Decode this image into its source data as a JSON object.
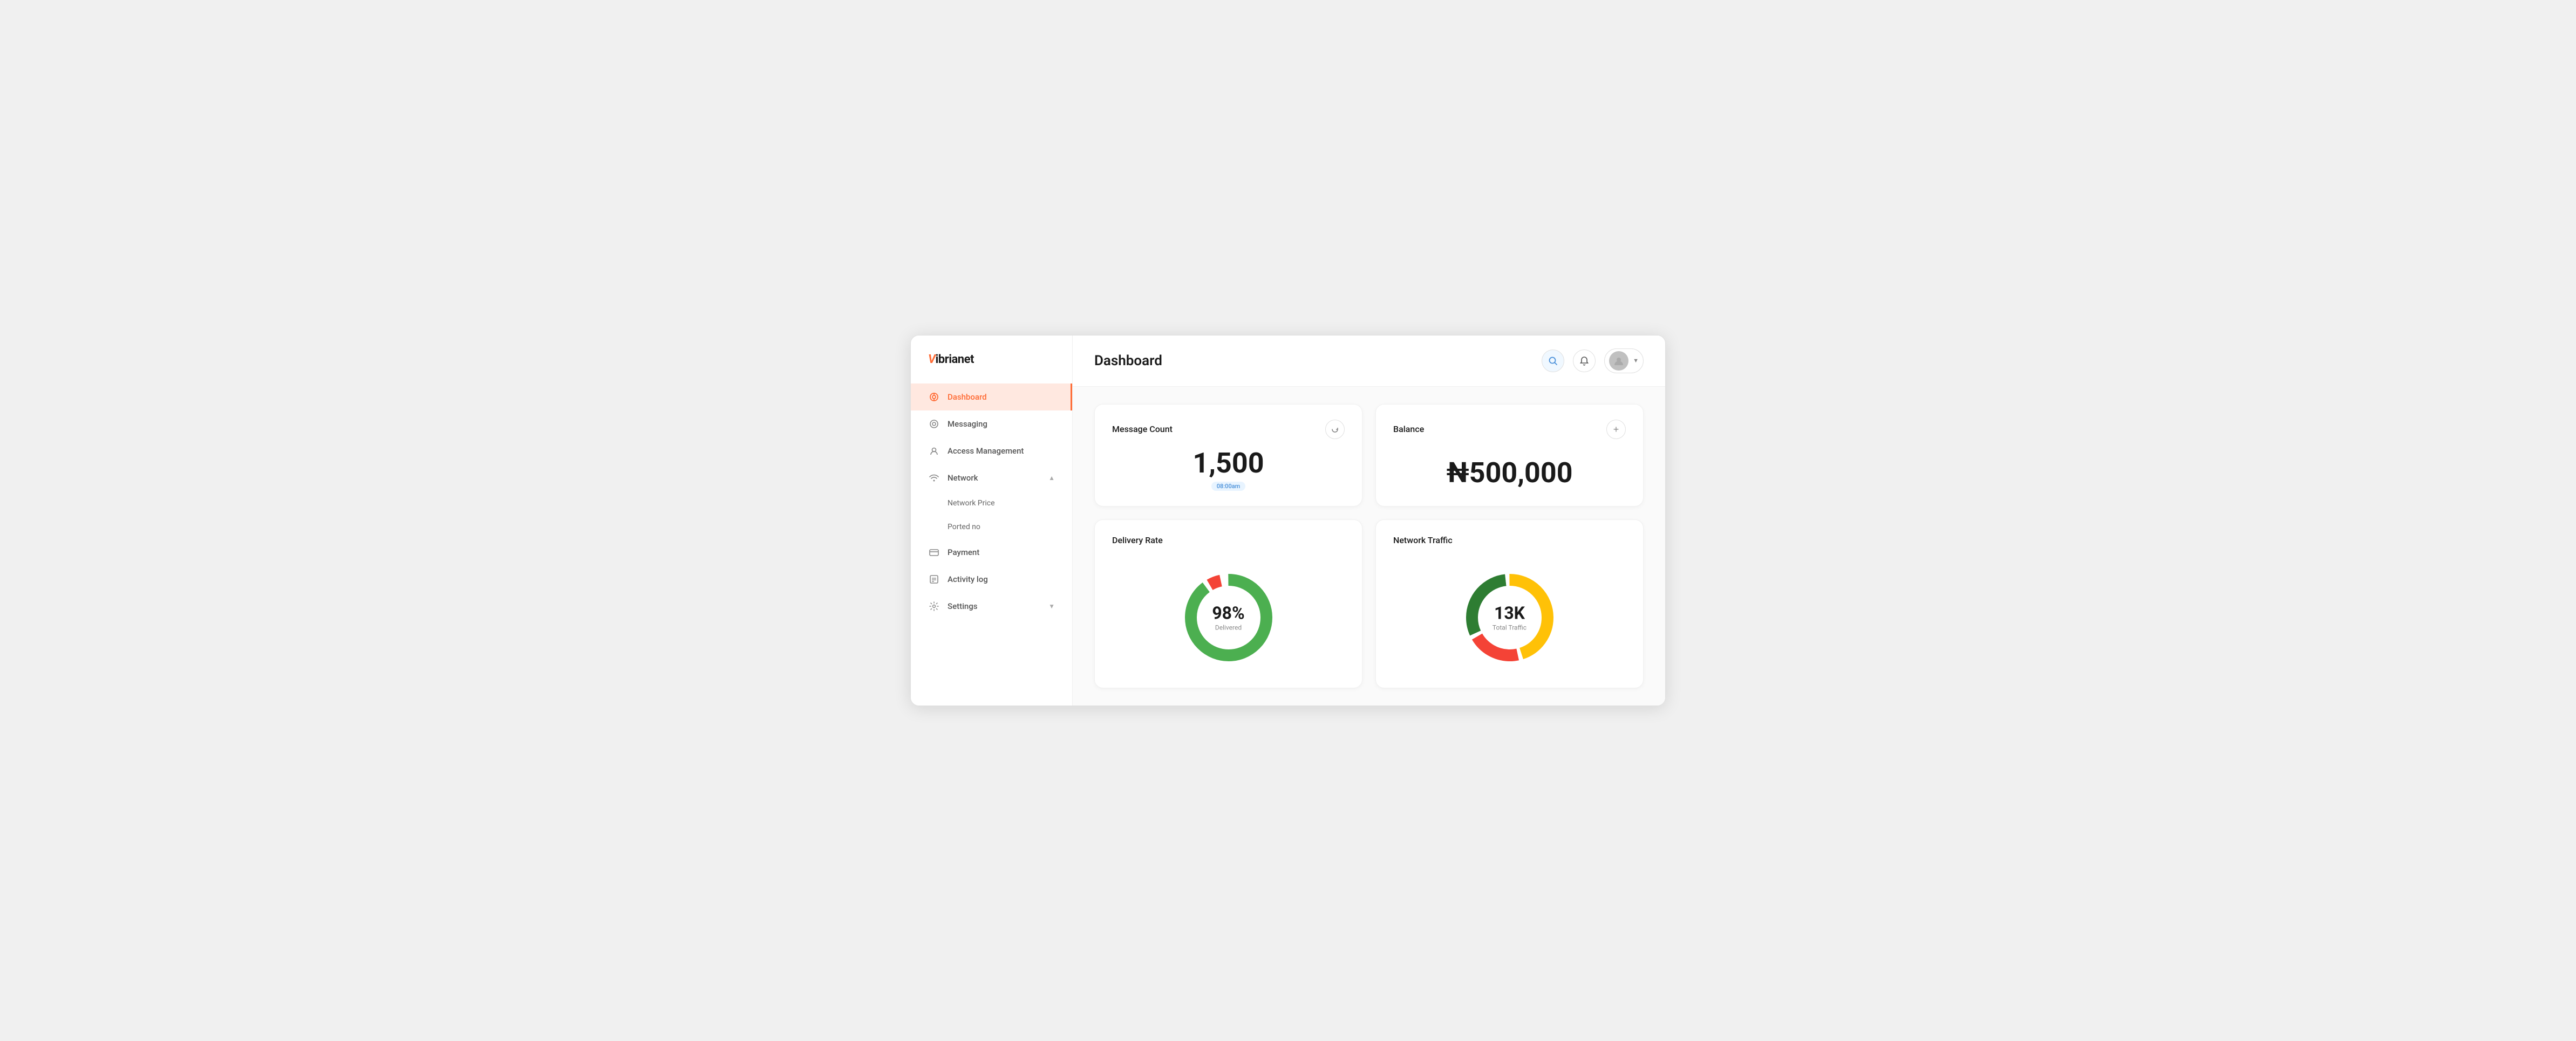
{
  "logo": {
    "prefix": "V",
    "suffix": "ibrianet"
  },
  "sidebar": {
    "items": [
      {
        "id": "dashboard",
        "label": "Dashboard",
        "icon": "dashboard-icon",
        "active": true,
        "sub": false
      },
      {
        "id": "messaging",
        "label": "Messaging",
        "icon": "messaging-icon",
        "active": false,
        "sub": false
      },
      {
        "id": "access-management",
        "label": "Access Management",
        "icon": "access-icon",
        "active": false,
        "sub": false
      },
      {
        "id": "network",
        "label": "Network",
        "icon": "network-icon",
        "active": false,
        "sub": false,
        "expandable": true,
        "expanded": true
      },
      {
        "id": "network-price",
        "label": "Network Price",
        "icon": null,
        "active": false,
        "sub": true
      },
      {
        "id": "ported-no",
        "label": "Ported no",
        "icon": null,
        "active": false,
        "sub": true
      },
      {
        "id": "payment",
        "label": "Payment",
        "icon": "payment-icon",
        "active": false,
        "sub": false
      },
      {
        "id": "activity-log",
        "label": "Activity log",
        "icon": "activity-icon",
        "active": false,
        "sub": false
      },
      {
        "id": "settings",
        "label": "Settings",
        "icon": "settings-icon",
        "active": false,
        "sub": false,
        "expandable": true,
        "expanded": false
      }
    ]
  },
  "header": {
    "title": "Dashboard",
    "search_icon": "search-icon",
    "bell_icon": "bell-icon",
    "avatar_icon": "user-icon"
  },
  "cards": {
    "message_count": {
      "title": "Message Count",
      "value": "1,500",
      "time": "08:00am",
      "icon": "refresh-icon"
    },
    "balance": {
      "title": "Balance",
      "value": "₦500,000",
      "icon": "plus-icon"
    },
    "delivery_rate": {
      "title": "Delivery Rate",
      "value": "98%",
      "label": "Delivered",
      "segments": [
        {
          "color": "#4CAF50",
          "percent": 90
        },
        {
          "color": "#F44336",
          "percent": 5
        },
        {
          "color": "#FF9800",
          "percent": 3
        },
        {
          "color": "#ffffff",
          "percent": 2
        }
      ]
    },
    "network_traffic": {
      "title": "Network Traffic",
      "value": "13K",
      "label": "Total Traffic",
      "segments": [
        {
          "color": "#FFC107",
          "percent": 45
        },
        {
          "color": "#F44336",
          "percent": 20
        },
        {
          "color": "#2E7D32",
          "percent": 30
        },
        {
          "color": "#ffffff",
          "percent": 5
        }
      ]
    }
  }
}
